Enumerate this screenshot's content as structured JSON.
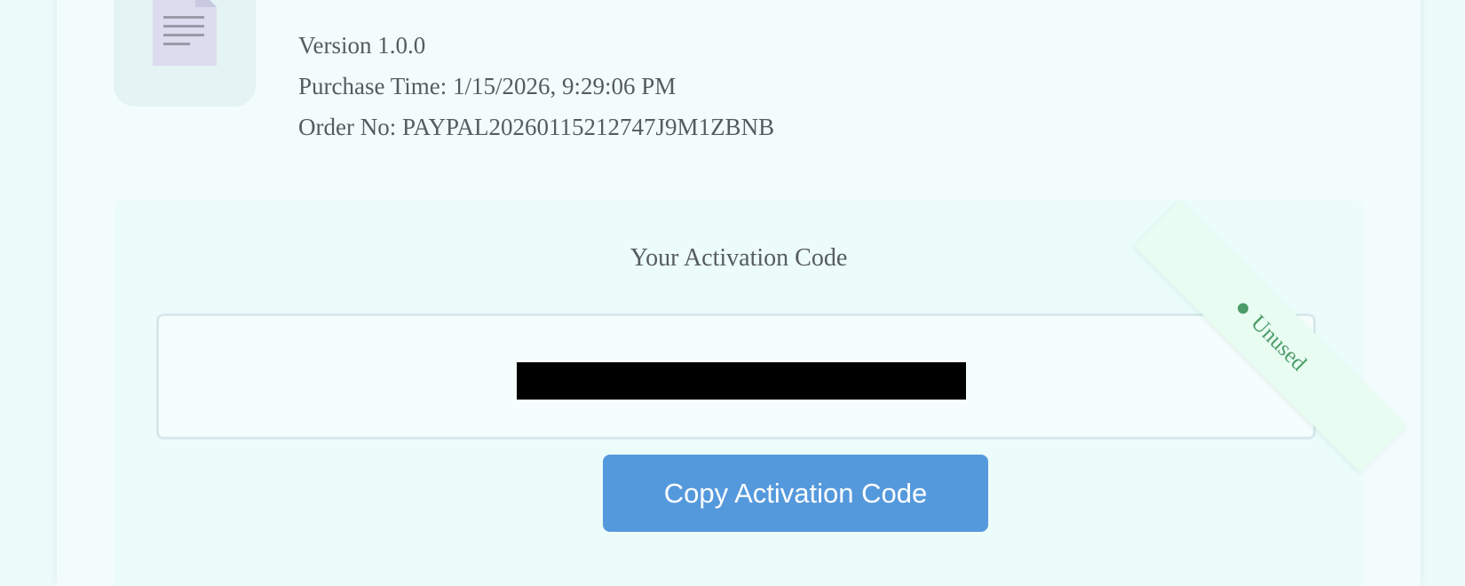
{
  "product": {
    "icon": "document-icon",
    "version": "Version 1.0.0",
    "purchase_time": "Purchase Time: 1/15/2026, 9:29:06 PM",
    "order_no": "Order No: PAYPAL20260115212747J9M1ZBNB"
  },
  "activation": {
    "title": "Your Activation Code",
    "code": "",
    "copy_label": "Copy Activation Code"
  },
  "status": {
    "label": "Unused",
    "color": "#4d9c68"
  },
  "colors": {
    "accent": "#5599dd",
    "background": "#eefbfb",
    "panel": "#ecfcfa",
    "text": "#555b60"
  }
}
